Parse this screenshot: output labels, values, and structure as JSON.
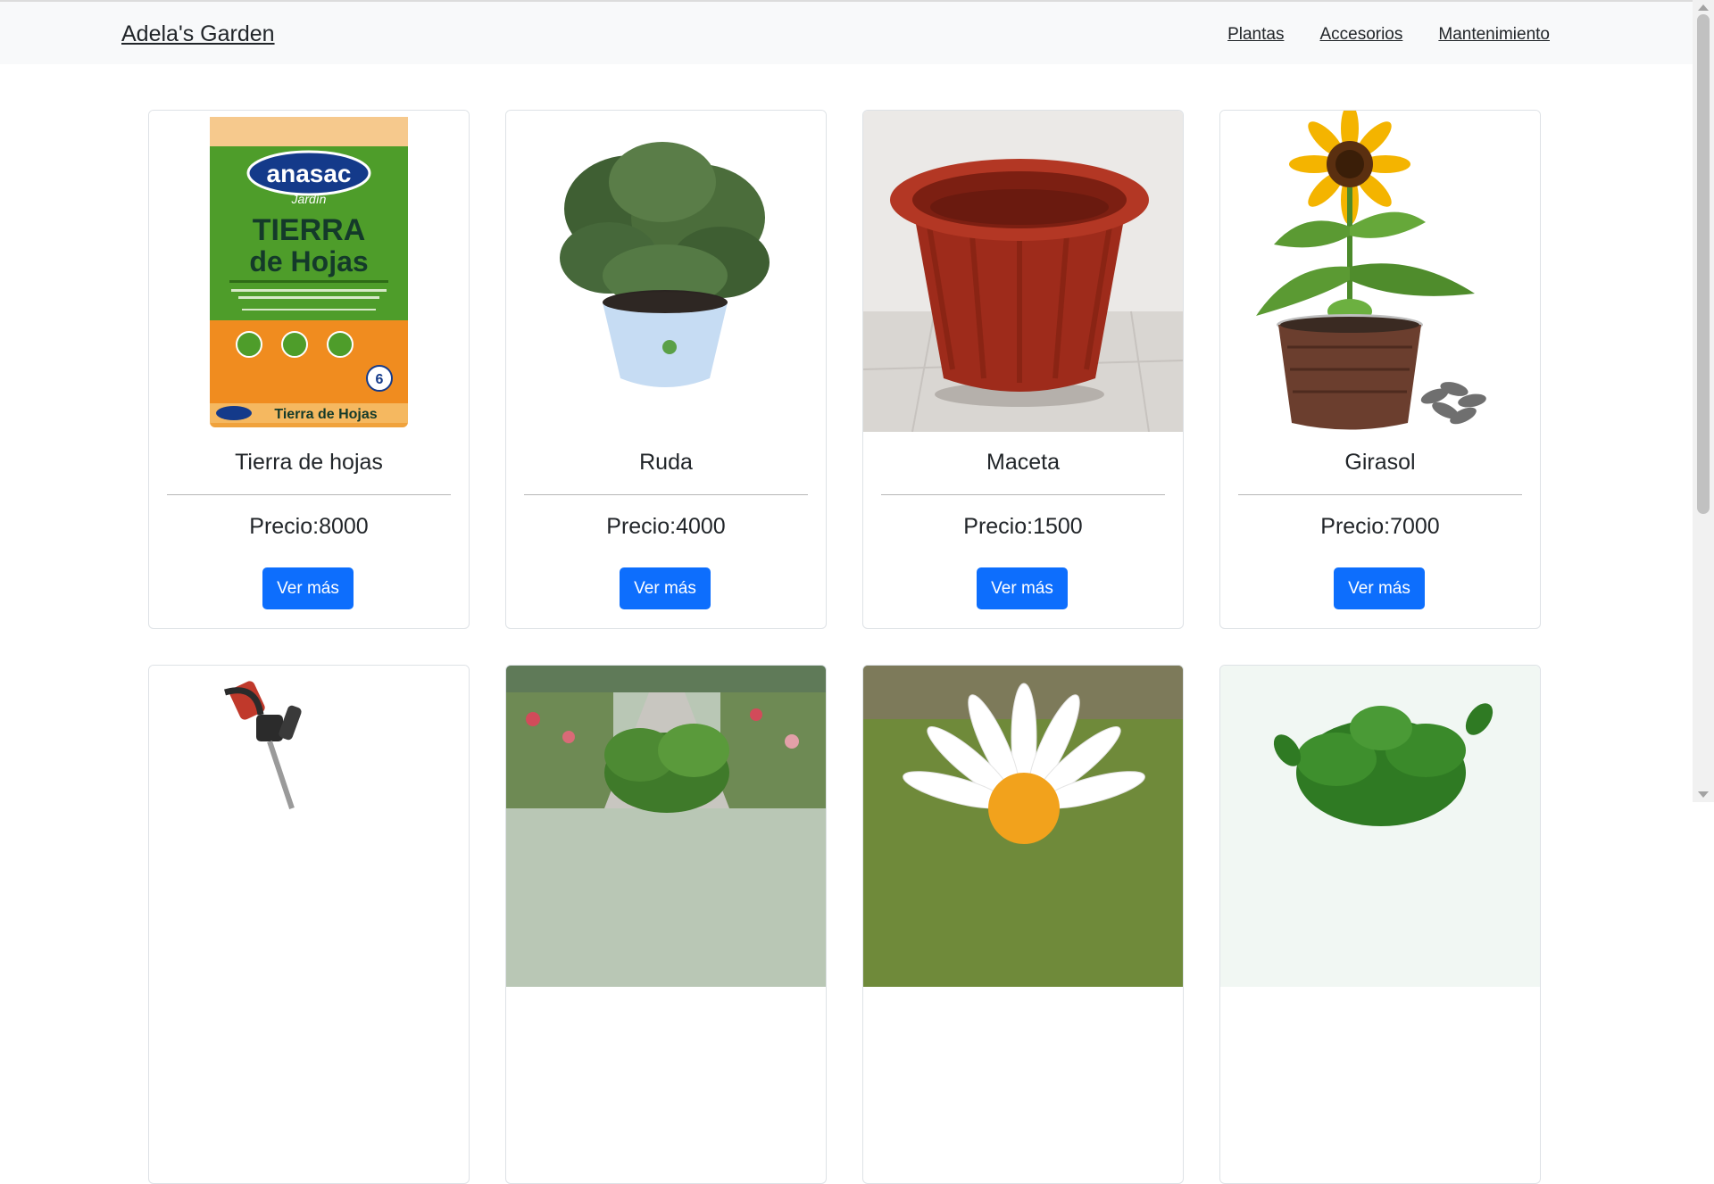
{
  "nav": {
    "brand": "Adela's Garden",
    "links": [
      "Plantas",
      "Accesorios",
      "Mantenimiento"
    ]
  },
  "products": [
    {
      "title": "Tierra de hojas",
      "price": "Precio:8000",
      "button": "Ver más",
      "image": "soil-bag-image"
    },
    {
      "title": "Ruda",
      "price": "Precio:4000",
      "button": "Ver más",
      "image": "rue-plant-image"
    },
    {
      "title": "Maceta",
      "price": "Precio:1500",
      "button": "Ver más",
      "image": "pot-image"
    },
    {
      "title": "Girasol",
      "price": "Precio:7000",
      "button": "Ver más",
      "image": "sunflower-image"
    }
  ],
  "product_images_row2": [
    "trimmer-image",
    "nursery-plant-image",
    "daisy-image",
    "green-plant-image"
  ],
  "bag_text": {
    "brand": "anasac",
    "sub": "Jardín",
    "line1": "TIERRA",
    "line2": "de Hojas",
    "footer": "Tierra de Hojas",
    "volume": "6"
  },
  "colors": {
    "primary": "#0d6efd",
    "navbar_bg": "#f8f9fa",
    "card_border": "#dee2e6"
  }
}
